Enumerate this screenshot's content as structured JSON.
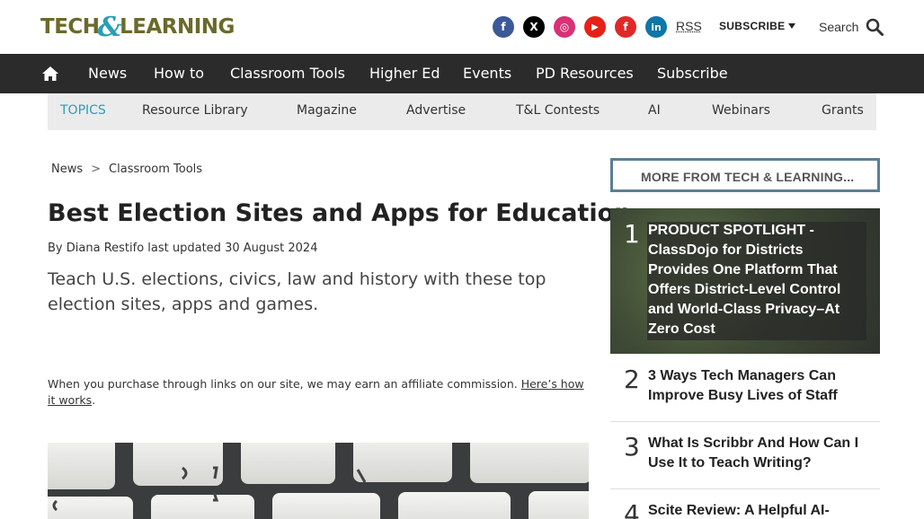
{
  "header": {
    "logo": {
      "part1": "TECH",
      "amp": "&",
      "part2": "LEARNING"
    },
    "socials": [
      {
        "name": "facebook",
        "glyph": "f",
        "color": "#3b5998"
      },
      {
        "name": "x",
        "glyph": "X",
        "color": "#000000"
      },
      {
        "name": "instagram",
        "glyph": "◎",
        "color": "#d93175"
      },
      {
        "name": "youtube",
        "glyph": "▶",
        "color": "#e62117"
      },
      {
        "name": "flipboard",
        "glyph": "f",
        "color": "#e12828"
      },
      {
        "name": "linkedin",
        "glyph": "in",
        "color": "#0e76a8"
      }
    ],
    "rss": "RSS",
    "subscribe": "SUBSCRIBE",
    "search": "Search"
  },
  "nav": {
    "items": [
      "News",
      "How to",
      "Classroom Tools",
      "Higher Ed",
      "Events",
      "PD Resources",
      "Subscribe"
    ]
  },
  "topics": {
    "label": "TOPICS",
    "items": [
      "Resource Library",
      "Magazine",
      "Advertise",
      "T&L Contests",
      "AI",
      "Webinars",
      "Grants"
    ]
  },
  "article": {
    "breadcrumb": [
      "News",
      "Classroom Tools"
    ],
    "breadcrumb_sep": ">",
    "title": "Best Election Sites and Apps for Education",
    "byline_prefix": "By",
    "author": "Diana Restifo",
    "byline_mid": "last updated",
    "date": "30 August 2024",
    "deck": "Teach U.S. elections, civics, law and history with these top election sites, apps and games.",
    "affiliate_text": "When you purchase through links on our site, we may earn an affiliate commission.",
    "affiliate_link": "Here’s how it works",
    "affiliate_end": "."
  },
  "sidebar": {
    "heading": "MORE FROM TECH & LEARNING...",
    "items": [
      {
        "num": "1",
        "text": "PRODUCT SPOTLIGHT - ClassDojo for Districts Provides One Platform That Offers District-Level Control and World-Class Privacy–At Zero Cost"
      },
      {
        "num": "2",
        "text": "3 Ways Tech Managers Can Improve Busy Lives of Staff"
      },
      {
        "num": "3",
        "text": "What Is Scribbr And How Can I Use It to Teach Writing?"
      },
      {
        "num": "4",
        "text": "Scite Review: A Helpful AI-"
      }
    ]
  }
}
